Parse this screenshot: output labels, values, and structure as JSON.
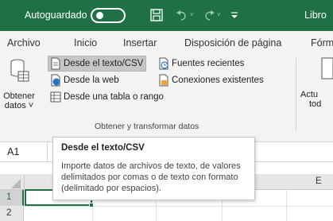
{
  "titlebar": {
    "autosave_label": "Autoguardado",
    "doc_title": "Libro",
    "accent_color": "#1f7145"
  },
  "tabs": [
    "Archivo",
    "Inicio",
    "Insertar",
    "Disposición de página",
    "Fórm"
  ],
  "ribbon": {
    "get_data": {
      "label_line1": "Obtener",
      "label_line2": "datos ˅"
    },
    "from_text_csv": "Desde el texto/CSV",
    "from_web": "Desde la web",
    "from_table": "Desde una tabla o rango",
    "recent_sources": "Fuentes recientes",
    "existing_connections": "Conexiones existentes",
    "refresh": {
      "label_line1": "Actu",
      "label_line2": "tod"
    },
    "group_label": "Obtener y transformar datos"
  },
  "formula_bar": {
    "namebox": "A1"
  },
  "grid": {
    "columns": [
      "E"
    ],
    "rows": [
      "1",
      "2"
    ]
  },
  "tooltip": {
    "title": "Desde el texto/CSV",
    "line1": "Importe datos de archivos de texto, de valores",
    "line2": "delimitados por comas o de texto con formato",
    "line3": "(delimitado por espacios)."
  }
}
